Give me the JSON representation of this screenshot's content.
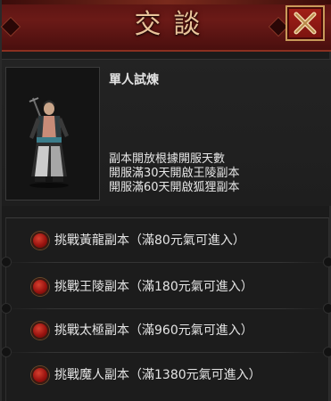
{
  "window": {
    "title": "交談",
    "close_icon": "close-x-icon"
  },
  "npc": {
    "name": "單人試煉",
    "portrait_icon": "warrior-portrait",
    "description": [
      "副本開放根據開服天數",
      "開服滿30天開啟王陵副本",
      "開服滿60天開啟狐狸副本"
    ]
  },
  "options": [
    {
      "label": "挑戰黃龍副本（滿80元氣可進入）"
    },
    {
      "label": "挑戰王陵副本（滿180元氣可進入）"
    },
    {
      "label": "挑戰太極副本（滿960元氣可進入）"
    },
    {
      "label": "挑戰魔人副本（滿1380元氣可進入）"
    }
  ],
  "colors": {
    "title_bar": "#6b1a17",
    "title_text": "#e9c39a",
    "close_button": "#a42018",
    "option_gem": "#9b1410",
    "text": "#e4e4e4"
  }
}
